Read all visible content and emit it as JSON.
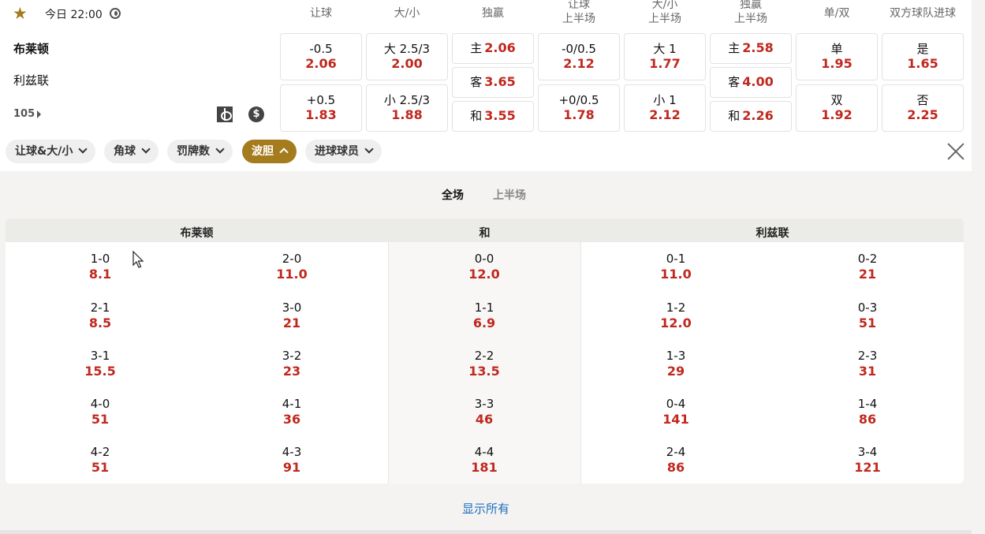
{
  "match": {
    "time": "今日 22:00",
    "home_team": "布莱顿",
    "away_team": "利兹联",
    "more_markets": "105"
  },
  "market_headers": [
    {
      "line1": "让球",
      "line2": ""
    },
    {
      "line1": "大/小",
      "line2": ""
    },
    {
      "line1": "独赢",
      "line2": ""
    },
    {
      "line1": "让球",
      "line2": "上半场"
    },
    {
      "line1": "大/小",
      "line2": "上半场"
    },
    {
      "line1": "独赢",
      "line2": "上半场"
    },
    {
      "line1": "单/双",
      "line2": ""
    },
    {
      "line1": "双方球队进球",
      "line2": ""
    }
  ],
  "odds": {
    "handicap": [
      {
        "label": "-0.5",
        "odd": "2.06"
      },
      {
        "label": "+0.5",
        "odd": "1.83"
      }
    ],
    "over_under": [
      {
        "label": "大 2.5/3",
        "odd": "2.00"
      },
      {
        "label": "小 2.5/3",
        "odd": "1.88"
      }
    ],
    "moneyline": [
      {
        "label": "主",
        "odd": "2.06"
      },
      {
        "label": "客",
        "odd": "3.65"
      },
      {
        "label": "和",
        "odd": "3.55"
      }
    ],
    "handicap_1h": [
      {
        "label": "-0/0.5",
        "odd": "2.12"
      },
      {
        "label": "+0/0.5",
        "odd": "1.78"
      }
    ],
    "over_under_1h": [
      {
        "label": "大 1",
        "odd": "1.77"
      },
      {
        "label": "小 1",
        "odd": "2.12"
      }
    ],
    "moneyline_1h": [
      {
        "label": "主",
        "odd": "2.58"
      },
      {
        "label": "客",
        "odd": "4.00"
      },
      {
        "label": "和",
        "odd": "2.26"
      }
    ],
    "odd_even": [
      {
        "label": "单",
        "odd": "1.95"
      },
      {
        "label": "双",
        "odd": "1.92"
      }
    ],
    "btts": [
      {
        "label": "是",
        "odd": "1.65"
      },
      {
        "label": "否",
        "odd": "2.25"
      }
    ]
  },
  "filters": [
    {
      "label": "让球&大/小",
      "active": false
    },
    {
      "label": "角球",
      "active": false
    },
    {
      "label": "罚牌数",
      "active": false
    },
    {
      "label": "波胆",
      "active": true
    },
    {
      "label": "进球球员",
      "active": false
    }
  ],
  "period_tabs": [
    {
      "label": "全场",
      "active": true
    },
    {
      "label": "上半场",
      "active": false
    }
  ],
  "correct_score": {
    "headers": {
      "home": "布莱顿",
      "draw": "和",
      "away": "利兹联"
    },
    "rows": [
      [
        {
          "score": "1-0",
          "price": "8.1"
        },
        {
          "score": "2-0",
          "price": "11.0"
        },
        {
          "score": "0-0",
          "price": "12.0"
        },
        {
          "score": "0-1",
          "price": "11.0"
        },
        {
          "score": "0-2",
          "price": "21"
        }
      ],
      [
        {
          "score": "2-1",
          "price": "8.5"
        },
        {
          "score": "3-0",
          "price": "21"
        },
        {
          "score": "1-1",
          "price": "6.9"
        },
        {
          "score": "1-2",
          "price": "12.0"
        },
        {
          "score": "0-3",
          "price": "51"
        }
      ],
      [
        {
          "score": "3-1",
          "price": "15.5"
        },
        {
          "score": "3-2",
          "price": "23"
        },
        {
          "score": "2-2",
          "price": "13.5"
        },
        {
          "score": "1-3",
          "price": "29"
        },
        {
          "score": "2-3",
          "price": "31"
        }
      ],
      [
        {
          "score": "4-0",
          "price": "51"
        },
        {
          "score": "4-1",
          "price": "36"
        },
        {
          "score": "3-3",
          "price": "46"
        },
        {
          "score": "0-4",
          "price": "141"
        },
        {
          "score": "1-4",
          "price": "86"
        }
      ],
      [
        {
          "score": "4-2",
          "price": "51"
        },
        {
          "score": "4-3",
          "price": "91"
        },
        {
          "score": "4-4",
          "price": "181"
        },
        {
          "score": "2-4",
          "price": "86"
        },
        {
          "score": "3-4",
          "price": "121"
        }
      ]
    ]
  },
  "show_all_label": "显示所有",
  "colors": {
    "accent": "#a47c1d",
    "odds_red": "#c0281f",
    "link_blue": "#1e6fc0"
  }
}
